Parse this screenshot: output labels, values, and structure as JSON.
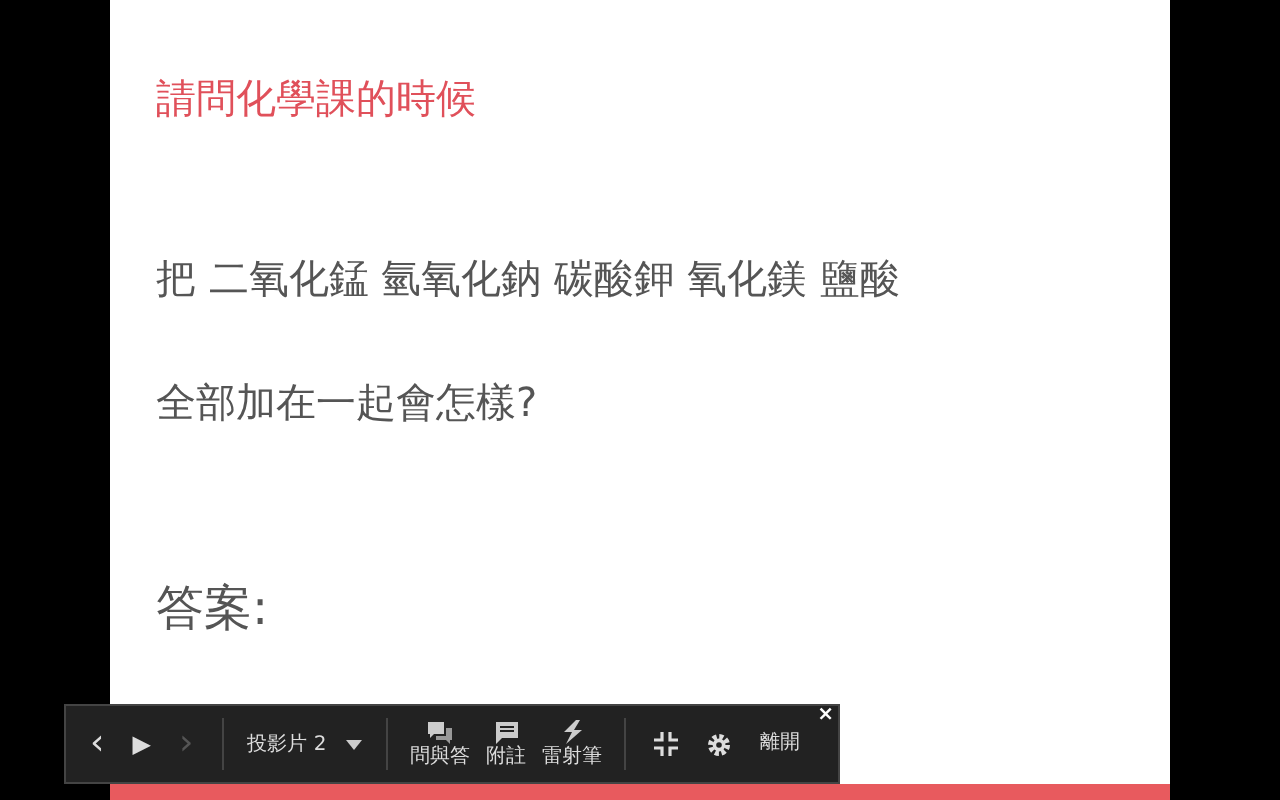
{
  "slide": {
    "title": "請問化學課的時候",
    "paragraphs": [
      "把 二氧化錳 氫氧化鈉 碳酸鉀 氧化鎂 鹽酸",
      "全部加在一起會怎樣?"
    ],
    "answer_heading": "答案:"
  },
  "toolbar": {
    "prev": {
      "label": "‹",
      "disabled": false
    },
    "play": "▶",
    "next": {
      "label": "›",
      "disabled": true
    },
    "slide_picker": "投影片 2",
    "tools": [
      {
        "kind": "qa",
        "label": "問與答"
      },
      {
        "kind": "notes",
        "label": "附註"
      },
      {
        "kind": "laser",
        "label": "雷射筆"
      }
    ],
    "exit": "離開",
    "close": "×"
  }
}
